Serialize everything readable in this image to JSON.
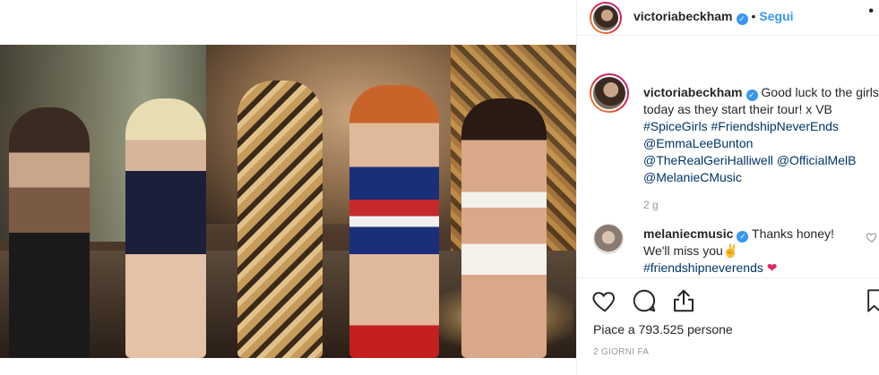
{
  "post": {
    "username": "victoriabeckham",
    "separator": "•",
    "follow_label": "Segui",
    "more_label": "•",
    "caption": {
      "username": "victoriabeckham",
      "text": "Good luck to the girls today as they start their tour! x VB",
      "hashtags": [
        "#SpiceGirls",
        "#FriendshipNeverEnds"
      ],
      "mentions": [
        "@EmmaLeeBunton",
        "@TheRealGeriHalliwell",
        "@OfficialMelB",
        "@MelanieCMusic"
      ],
      "time_ago": "2 g"
    },
    "reply": {
      "username": "melaniecmusic",
      "text_1": "Thanks honey!",
      "text_2": "We'll miss you",
      "emoji_hand": "✌",
      "hashtag": "#friendshipneverends",
      "emoji_heart": "❤"
    },
    "likes_text": "Piace a 793.525 persone",
    "date_text": "2 GIORNI FA"
  },
  "icons": {
    "verified": "verified-badge-icon",
    "like": "heart-icon",
    "comment": "comment-icon",
    "share": "share-icon",
    "save": "bookmark-icon"
  },
  "colors": {
    "link": "#3897f0",
    "tag": "#003569",
    "verified": "#3897f0",
    "heart": "#e0245e"
  }
}
